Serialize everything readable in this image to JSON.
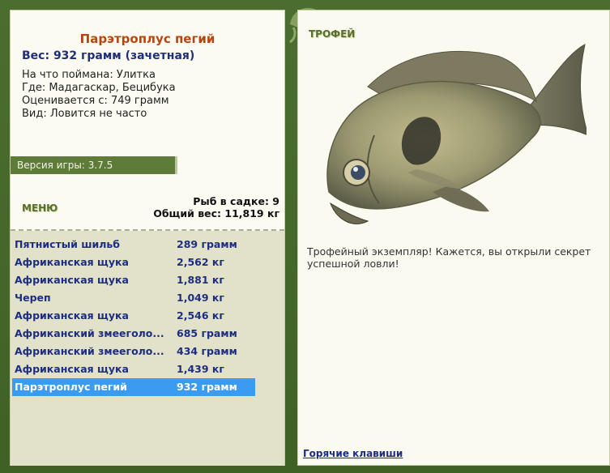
{
  "fish_card": {
    "title": "Парэтроплус пегий",
    "weight_line": "Вес: 932 грамм (зачетная)",
    "info": [
      "На что поймана: Улитка",
      "Где: Мадагаскар, Бецибука",
      "Оценивается с: 749 грамм",
      "Вид: Ловится не часто"
    ]
  },
  "version": "Версия игры: 3.7.5",
  "menu_label": "МЕНЮ",
  "stats": {
    "fish_in_keepnet": "Рыб в садке: 9",
    "total_weight": "Общий вес: 11,819 кг"
  },
  "catch_list": [
    {
      "name": "Пятнистый шильб",
      "weight": "289 грамм"
    },
    {
      "name": "Африканская щука",
      "weight": "2,562 кг"
    },
    {
      "name": "Африканская щука",
      "weight": "1,881 кг"
    },
    {
      "name": "Череп",
      "weight": "1,049 кг"
    },
    {
      "name": "Африканская щука",
      "weight": "2,546 кг"
    },
    {
      "name": "Африканский змееголо...",
      "weight": "685 грамм"
    },
    {
      "name": "Африканский змееголо...",
      "weight": "434 грамм"
    },
    {
      "name": "Африканская щука",
      "weight": "1,439 кг"
    },
    {
      "name": "Парэтроплус пегий",
      "weight": "932 грамм"
    }
  ],
  "selected_index": 8,
  "trophy": {
    "label": "ТРОФЕЙ",
    "text": "Трофейный экземпляр! Кажется, вы открыли секрет успешной ловли!"
  },
  "hotkeys_link": "Горячие клавиши",
  "colors": {
    "frame": "#46682b",
    "title": "#b6460f",
    "link": "#1d2e80",
    "selected": "#3a9bf0"
  }
}
